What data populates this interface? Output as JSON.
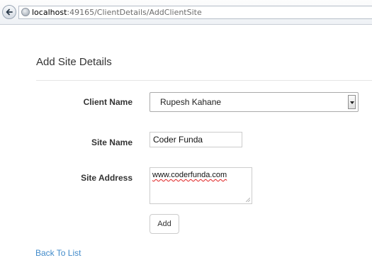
{
  "browser": {
    "url_host": "localhost",
    "url_path": ":49165/ClientDetails/AddClientSite"
  },
  "page": {
    "title": "Add Site Details"
  },
  "form": {
    "client_name_label": "Client Name",
    "client_name_value": "Rupesh Kahane",
    "site_name_label": "Site Name",
    "site_name_value": "Coder Funda",
    "site_address_label": "Site Address",
    "site_address_value": "www.coderfunda.com",
    "add_label": "Add"
  },
  "footer": {
    "back_link": "Back To List"
  },
  "icons": {
    "back": "back-arrow-icon",
    "page": "page-icon",
    "dropdown": "chevron-down-icon"
  },
  "colors": {
    "link": "#428bca",
    "text": "#333333",
    "spellcheck": "#e02020"
  }
}
